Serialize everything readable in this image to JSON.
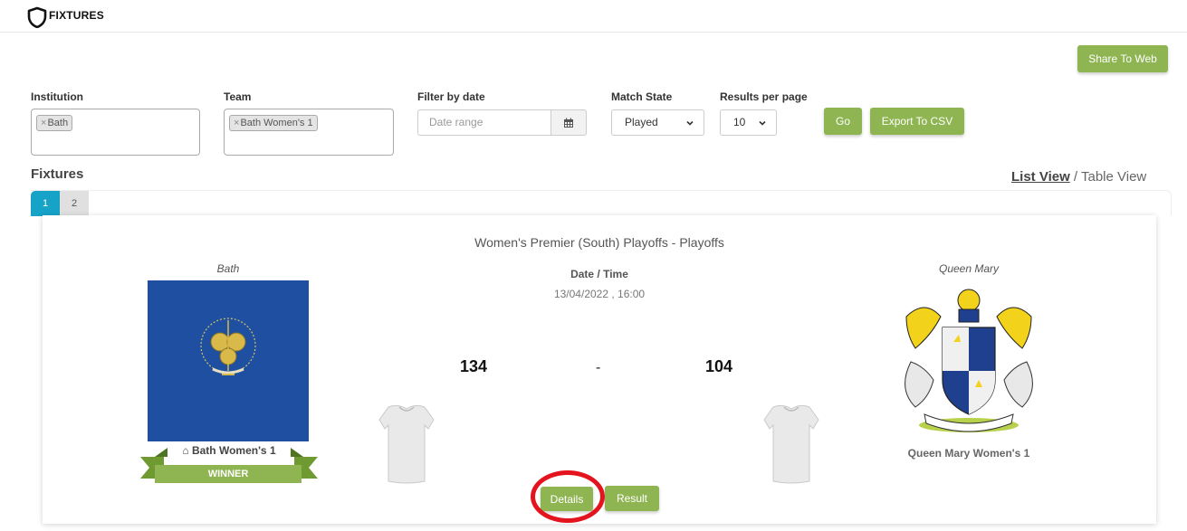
{
  "header": {
    "title": "FIXTURES",
    "logo_icon": "shield-icon"
  },
  "toolbar": {
    "share_label": "Share To Web"
  },
  "filters": {
    "institution": {
      "label": "Institution",
      "tags": [
        "Bath"
      ]
    },
    "team": {
      "label": "Team",
      "tags": [
        "Bath Women's 1"
      ]
    },
    "date": {
      "label": "Filter by date",
      "placeholder": "Date range",
      "icon": "calendar-icon"
    },
    "match_state": {
      "label": "Match State",
      "value": "Played"
    },
    "results_per_page": {
      "label": "Results per page",
      "value": "10"
    },
    "go_label": "Go",
    "export_label": "Export To CSV",
    "tag_remove": "×"
  },
  "fixtures": {
    "title": "Fixtures",
    "view_list": "List View",
    "view_separator": " / ",
    "view_table": "Table View",
    "pages": [
      "1",
      "2"
    ],
    "active_page": "1"
  },
  "match": {
    "competition": "Women's Premier (South) Playoffs - Playoffs",
    "home": {
      "institution": "Bath",
      "team": "Bath Women's 1",
      "score": "134",
      "status": "WINNER",
      "home_icon": "home-icon"
    },
    "away": {
      "institution": "Queen Mary",
      "team": "Queen Mary Women's 1",
      "score": "104"
    },
    "datetime_label": "Date / Time",
    "datetime_value": "13/04/2022 , 16:00",
    "separator": "-",
    "details_label": "Details",
    "result_label": "Result"
  },
  "colors": {
    "accent_green": "#8fb552",
    "page_active": "#17a2c8",
    "bath_blue": "#1f4fa0",
    "highlight_red": "#e3141d"
  }
}
